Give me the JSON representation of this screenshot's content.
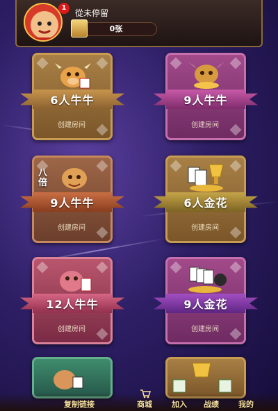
{
  "header": {
    "username": "從未停留",
    "card_count": "0张",
    "badge": "1"
  },
  "rooms": [
    {
      "title": "6人牛牛",
      "action": "创建房间"
    },
    {
      "title": "9人牛牛",
      "action": "创建房间"
    },
    {
      "title": "9人牛牛",
      "action": "创建房间",
      "tag": "八倍"
    },
    {
      "title": "6人金花",
      "action": "创建房间"
    },
    {
      "title": "12人牛牛",
      "action": "创建房间"
    },
    {
      "title": "9人金花",
      "action": "创建房间"
    }
  ],
  "nav": {
    "copy_link": "复制链接",
    "shop": "商城",
    "join": "加入",
    "records": "战绩",
    "mine": "我的"
  }
}
